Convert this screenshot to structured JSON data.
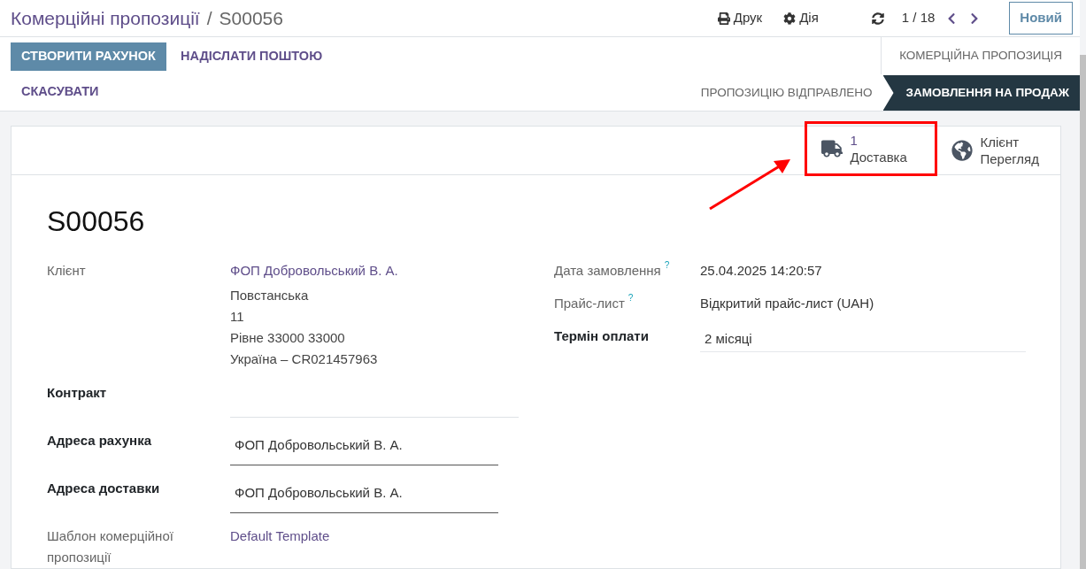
{
  "breadcrumb": {
    "parent": "Комерційні пропозиції",
    "separator": "/",
    "current": "S00056"
  },
  "toolbar": {
    "print": "Друк",
    "action": "Дія",
    "pager": "1 / 18",
    "new_button": "Новий"
  },
  "action_buttons": [
    {
      "label": "СТВОРИТИ РАХУНОК",
      "primary": true
    },
    {
      "label": "НАДІСЛАТИ ПОШТОЮ",
      "primary": false
    },
    {
      "label": "СКАСУВАТИ",
      "primary": false
    }
  ],
  "statuses": [
    {
      "label": "КОМЕРЦІЙНА ПРОПОЗИЦІЯ",
      "selected": false
    },
    {
      "label": "ПРОПОЗИЦІЮ ВІДПРАВЛЕНО",
      "selected": false
    },
    {
      "label": "ЗАМОВЛЕННЯ НА ПРОДАЖ",
      "selected": true
    }
  ],
  "smart_buttons": [
    {
      "kind": "delivery",
      "count": "1",
      "label": "Доставка",
      "highlighted": true
    },
    {
      "kind": "customer",
      "title": "Клієнт",
      "label": "Перегляд",
      "highlighted": false
    }
  ],
  "record_name": "S00056",
  "fields_left": [
    {
      "label": "Клієнт",
      "required": false,
      "kind": "link_address",
      "value": "ФОП Добровольський В. А.",
      "lines": [
        "Повстанська",
        "11",
        "Рівне 33000 33000",
        "Україна – CR021457963"
      ]
    },
    {
      "label": "Контракт",
      "required": true,
      "kind": "empty_input"
    },
    {
      "label": "Адреса рахунка",
      "required": true,
      "kind": "input",
      "value": "ФОП Добровольський В. А."
    },
    {
      "label": "Адреса доставки",
      "required": true,
      "kind": "input",
      "value": "ФОП Добровольський В. А."
    },
    {
      "label": "Шаблон комерційної пропозиції",
      "required": false,
      "kind": "link",
      "value": "Default Template"
    }
  ],
  "fields_right": [
    {
      "label": "Дата замовлення",
      "help": "?",
      "required": false,
      "kind": "text",
      "value": "25.04.2025 14:20:57"
    },
    {
      "label": "Прайс-лист",
      "help": "?",
      "required": false,
      "kind": "text",
      "value": "Відкритий прайс-лист (UAH)"
    },
    {
      "label": "Термін оплати",
      "required": true,
      "kind": "soft_input",
      "value": "2 місяці"
    }
  ]
}
